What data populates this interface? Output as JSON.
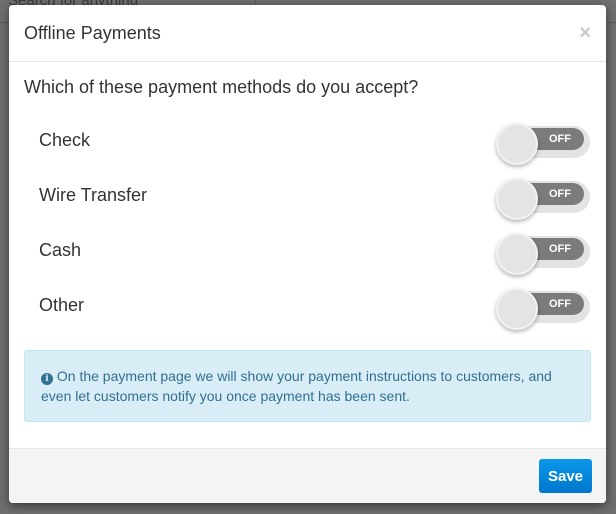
{
  "background": {
    "search_placeholder": "Search for anything"
  },
  "modal": {
    "title": "Offline Payments",
    "close_icon": "×",
    "question": "Which of these payment methods do you accept?",
    "methods": [
      {
        "label": "Check",
        "state": "OFF"
      },
      {
        "label": "Wire Transfer",
        "state": "OFF"
      },
      {
        "label": "Cash",
        "state": "OFF"
      },
      {
        "label": "Other",
        "state": "OFF"
      }
    ],
    "info_icon": "i",
    "info_text": "On the payment page we will show your payment instructions to customers, and even let customers notify you once payment has been sent.",
    "save_label": "Save"
  }
}
